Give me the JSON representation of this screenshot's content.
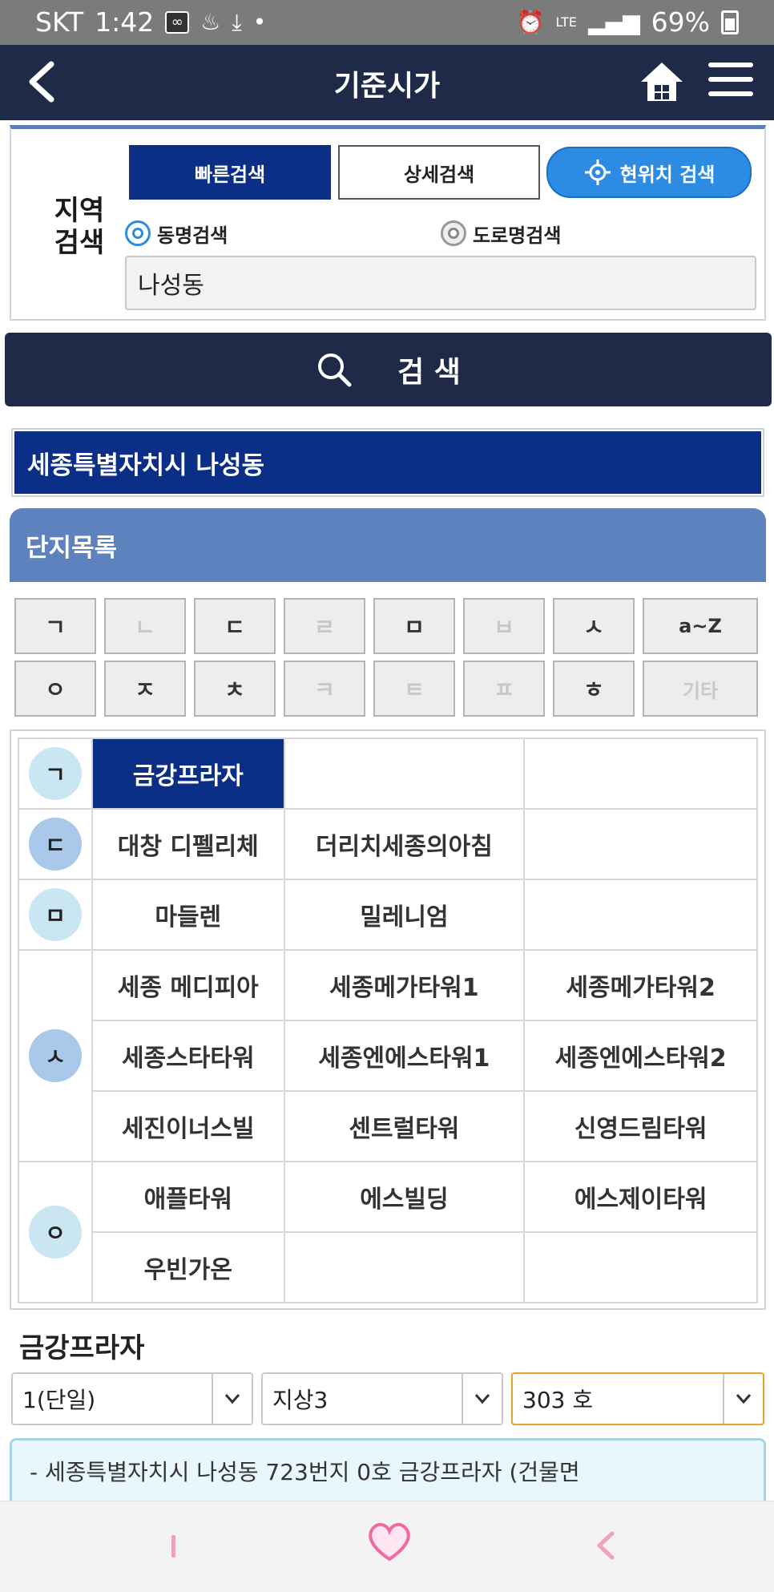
{
  "status_bar": {
    "carrier": "SKT",
    "time": "1:42",
    "battery": "69%",
    "net": "LTE"
  },
  "nav": {
    "title": "기준시가"
  },
  "search": {
    "region_label_line1": "지역",
    "region_label_line2": "검색",
    "tab_quick": "빠른검색",
    "tab_detail": "상세검색",
    "tab_location": "현위치 검색",
    "radio_dong": "동명검색",
    "radio_road": "도로명검색",
    "query": "나성동",
    "search_button": "검 색"
  },
  "result": {
    "region": "세종특별자치시 나성동",
    "list_title": "단지목록"
  },
  "keys": {
    "row1": [
      "ㄱ",
      "ㄴ",
      "ㄷ",
      "ㄹ",
      "ㅁ",
      "ㅂ",
      "ㅅ",
      "a~Z"
    ],
    "row2": [
      "ㅇ",
      "ㅈ",
      "ㅊ",
      "ㅋ",
      "ㅌ",
      "ㅍ",
      "ㅎ",
      "기타"
    ]
  },
  "complexes": {
    "g_initial": "ㄱ",
    "d_initial": "ㄷ",
    "m_initial": "ㅁ",
    "s_initial": "ㅅ",
    "o_initial": "ㅇ",
    "g": [
      "금강프라자"
    ],
    "d": [
      "대창 디펠리체",
      "더리치세종의아침"
    ],
    "m": [
      "마들렌",
      "밀레니엄"
    ],
    "s": [
      "세종 메디피아",
      "세종메가타워1",
      "세종메가타워2",
      "세종스타타워",
      "세종엔에스타워1",
      "세종엔에스타워2",
      "세진이너스빌",
      "센트럴타워",
      "신영드림타워"
    ],
    "o": [
      "애플타워",
      "에스빌딩",
      "에스제이타워",
      "우빈가온"
    ]
  },
  "building": {
    "name": "금강프라자",
    "dong": "1(단일)",
    "floor": "지상3",
    "unit": "303 호",
    "address": "- 세종특별자치시 나성동 723번지 0호 금강프라자 (건물면"
  },
  "colors": {
    "navy": "#1f2a48",
    "selected": "#0b2f86",
    "header": "#5e82bd",
    "accent": "#2c8be2"
  }
}
